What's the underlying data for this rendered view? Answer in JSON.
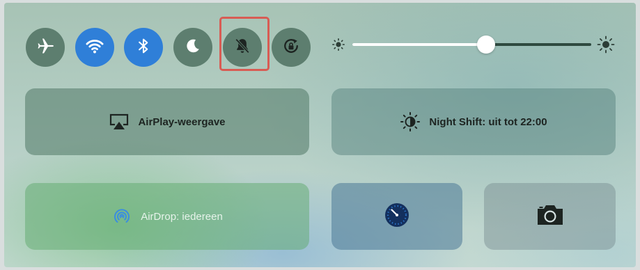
{
  "toggles": [
    {
      "name": "airplane-mode",
      "icon": "airplane-icon",
      "state": "off"
    },
    {
      "name": "wifi",
      "icon": "wifi-icon",
      "state": "on"
    },
    {
      "name": "bluetooth",
      "icon": "bluetooth-icon",
      "state": "on"
    },
    {
      "name": "do-not-disturb",
      "icon": "moon-icon",
      "state": "off"
    },
    {
      "name": "mute",
      "icon": "bell-slash-icon",
      "state": "off",
      "highlighted": true
    },
    {
      "name": "orientation-lock",
      "icon": "rotation-lock-icon",
      "state": "off"
    }
  ],
  "brightness": {
    "level": 0.56
  },
  "tiles": {
    "airplay": {
      "label": "AirPlay-weergave",
      "icon": "airplay-icon"
    },
    "night_shift": {
      "label": "Night Shift: uit tot 22:00",
      "icon": "night-shift-sun-icon"
    },
    "airdrop": {
      "label": "AirDrop: iedereen",
      "icon": "airdrop-icon"
    },
    "timer": {
      "icon": "timer-icon"
    },
    "camera": {
      "icon": "camera-icon"
    }
  },
  "colors": {
    "toggle_on": "#2f7fd8",
    "toggle_off": "#5d7e6f",
    "highlight_border": "#d85c54"
  }
}
